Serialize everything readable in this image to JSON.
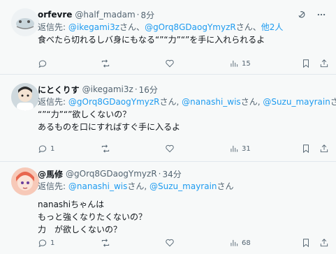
{
  "tweets": [
    {
      "name": "orfevre",
      "handle": "@half_madam",
      "dot": "·",
      "time": "8分",
      "reply_prefix": "返信先:",
      "reply_mentions": [
        "@ikegami3z",
        "@gOrq8GDaogYmyzR",
        "他2人"
      ],
      "reply_suffixes": [
        "さん、",
        "さん、",
        ""
      ],
      "text": "食べたら切れるしバ身にもなる“”“力”“”を手に入れられるよ",
      "replies": "",
      "retweets": "",
      "likes": "",
      "views": "15"
    },
    {
      "name": "にとくりす",
      "handle": "@ikegami3z",
      "dot": "·",
      "time": "16分",
      "reply_prefix": "返信先:",
      "reply_mentions": [
        "@gOrq8GDaogYmyzR",
        "@nanashi_wis",
        "@Suzu_mayrain"
      ],
      "reply_suffixes": [
        "さん, ",
        "さん, ",
        "さん"
      ],
      "text": "“”“力”“”欲しくないの？\nあるものを口にすればすぐ手に入るよ",
      "replies": "1",
      "retweets": "",
      "likes": "",
      "views": "31"
    },
    {
      "name": "@馬修",
      "handle": "@gOrq8GDaogYmyzR",
      "dot": "·",
      "time": "34分",
      "reply_prefix": "返信先:",
      "reply_mentions": [
        "@nanashi_wis",
        "@Suzu_mayrain"
      ],
      "reply_suffixes": [
        "さん, ",
        "さん"
      ],
      "text": "nanashiちゃんは\nもっと強くなりたくないの？\n力　が欲しくないの？",
      "replies": "1",
      "retweets": "",
      "likes": "",
      "views": "68"
    }
  ],
  "icons": {
    "grok": "grok-icon",
    "more": "more-icon",
    "reply": "reply-icon",
    "retweet": "retweet-icon",
    "like": "like-icon",
    "views": "views-icon",
    "bookmark": "bookmark-icon",
    "share": "share-icon"
  },
  "colors": {
    "accent": "#1d9bf0",
    "muted": "#536471",
    "text": "#0f1419",
    "background": "#f7f9f9"
  }
}
